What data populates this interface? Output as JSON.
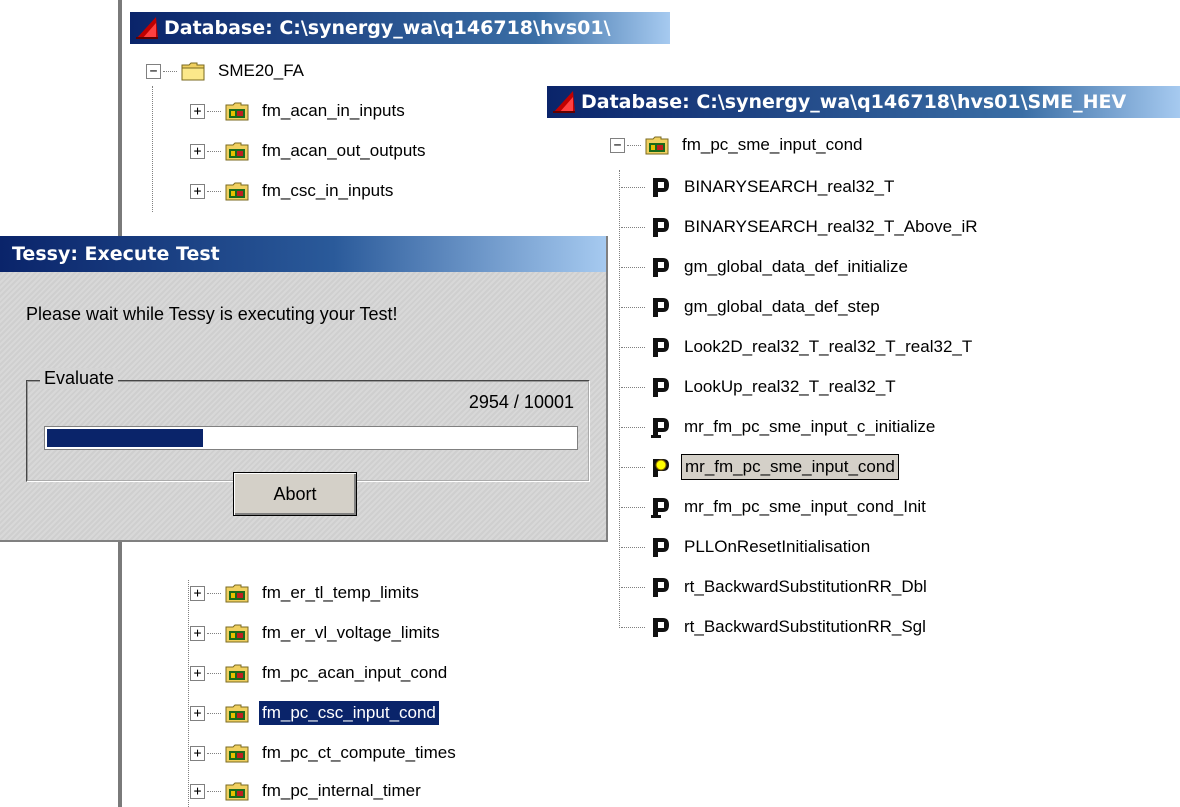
{
  "left_window": {
    "title": "Database: C:\\synergy_wa\\q146718\\hvs01\\",
    "root": {
      "label": "SME20_FA",
      "expander": "−"
    },
    "items_top": [
      {
        "label": "fm_acan_in_inputs",
        "expander": "+"
      },
      {
        "label": "fm_acan_out_outputs",
        "expander": "+"
      },
      {
        "label": "fm_csc_in_inputs",
        "expander": "+"
      }
    ],
    "items_bottom": [
      {
        "label": "fm_er_tl_temp_limits",
        "expander": "+"
      },
      {
        "label": "fm_er_vl_voltage_limits",
        "expander": "+"
      },
      {
        "label": "fm_pc_acan_input_cond",
        "expander": "+"
      },
      {
        "label": "fm_pc_csc_input_cond",
        "expander": "+",
        "selected": true
      },
      {
        "label": "fm_pc_ct_compute_times",
        "expander": "+"
      },
      {
        "label": "fm_pc_internal_timer",
        "expander": "+"
      }
    ]
  },
  "right_window": {
    "title": "Database: C:\\synergy_wa\\q146718\\hvs01\\SME_HEV",
    "module": {
      "label": "fm_pc_sme_input_cond",
      "expander": "−"
    },
    "functions": [
      {
        "label": "BINARYSEARCH_real32_T",
        "icon": "function-icon"
      },
      {
        "label": "BINARYSEARCH_real32_T_Above_iR",
        "icon": "function-icon"
      },
      {
        "label": "gm_global_data_def_initialize",
        "icon": "function-icon"
      },
      {
        "label": "gm_global_data_def_step",
        "icon": "function-icon"
      },
      {
        "label": "Look2D_real32_T_real32_T_real32_T",
        "icon": "function-icon"
      },
      {
        "label": "LookUp_real32_T_real32_T",
        "icon": "function-icon"
      },
      {
        "label": "mr_fm_pc_sme_input_c_initialize",
        "icon": "function-init-icon"
      },
      {
        "label": "mr_fm_pc_sme_input_cond",
        "icon": "function-running-icon",
        "boxed": true
      },
      {
        "label": "mr_fm_pc_sme_input_cond_Init",
        "icon": "function-init-icon"
      },
      {
        "label": "PLLOnResetInitialisation",
        "icon": "function-icon"
      },
      {
        "label": "rt_BackwardSubstitutionRR_Dbl",
        "icon": "function-icon"
      },
      {
        "label": "rt_BackwardSubstitutionRR_Sgl",
        "icon": "function-icon"
      }
    ]
  },
  "dialog": {
    "title": "Tessy: Execute Test",
    "message": "Please wait while Tessy is executing your Test!",
    "group_label": "Evaluate",
    "progress_text": "2954 / 10001",
    "progress_fraction": 0.2954,
    "abort_label": "Abort"
  },
  "colors": {
    "titlebar_blue": "#0a246a",
    "selection_blue": "#0a246a",
    "folder_yellow": "#f0d060",
    "func_icon_yellow": "#ffff00"
  }
}
